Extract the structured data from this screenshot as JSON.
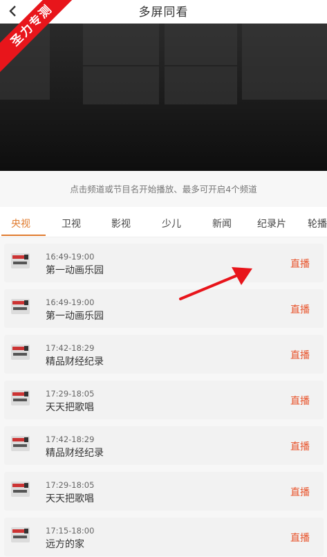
{
  "header": {
    "title": "多屏同看",
    "back_icon": "chevron-left-icon"
  },
  "ribbon": {
    "text": "圣力专测"
  },
  "hint": {
    "text": "点击频道或节目名开始播放、最多可开启4个频道"
  },
  "tabs": [
    {
      "label": "央视",
      "active": true
    },
    {
      "label": "卫视"
    },
    {
      "label": "影视"
    },
    {
      "label": "少儿"
    },
    {
      "label": "新闻"
    },
    {
      "label": "纪录片"
    },
    {
      "label": "轮播"
    }
  ],
  "channels": [
    {
      "logo": "cctv-logo",
      "time": "16:49-19:00",
      "program": "第一动画乐园",
      "action": "直播"
    },
    {
      "logo": "cctv-logo",
      "time": "16:49-19:00",
      "program": "第一动画乐园",
      "action": "直播"
    },
    {
      "logo": "cctv-logo",
      "time": "17:42-18:29",
      "program": "精品财经纪录",
      "action": "直播"
    },
    {
      "logo": "cctv-logo",
      "time": "17:29-18:05",
      "program": "天天把歌唱",
      "action": "直播"
    },
    {
      "logo": "cctv-logo",
      "time": "17:42-18:29",
      "program": "精品财经纪录",
      "action": "直播"
    },
    {
      "logo": "cctv-logo",
      "time": "17:29-18:05",
      "program": "天天把歌唱",
      "action": "直播"
    },
    {
      "logo": "cctv-logo",
      "time": "17:15-18:00",
      "program": "远方的家",
      "action": "直播"
    }
  ],
  "colors": {
    "accent": "#e07b2e",
    "live": "#e8532a",
    "ribbon": "#e8151b",
    "arrow": "#e8151b"
  }
}
